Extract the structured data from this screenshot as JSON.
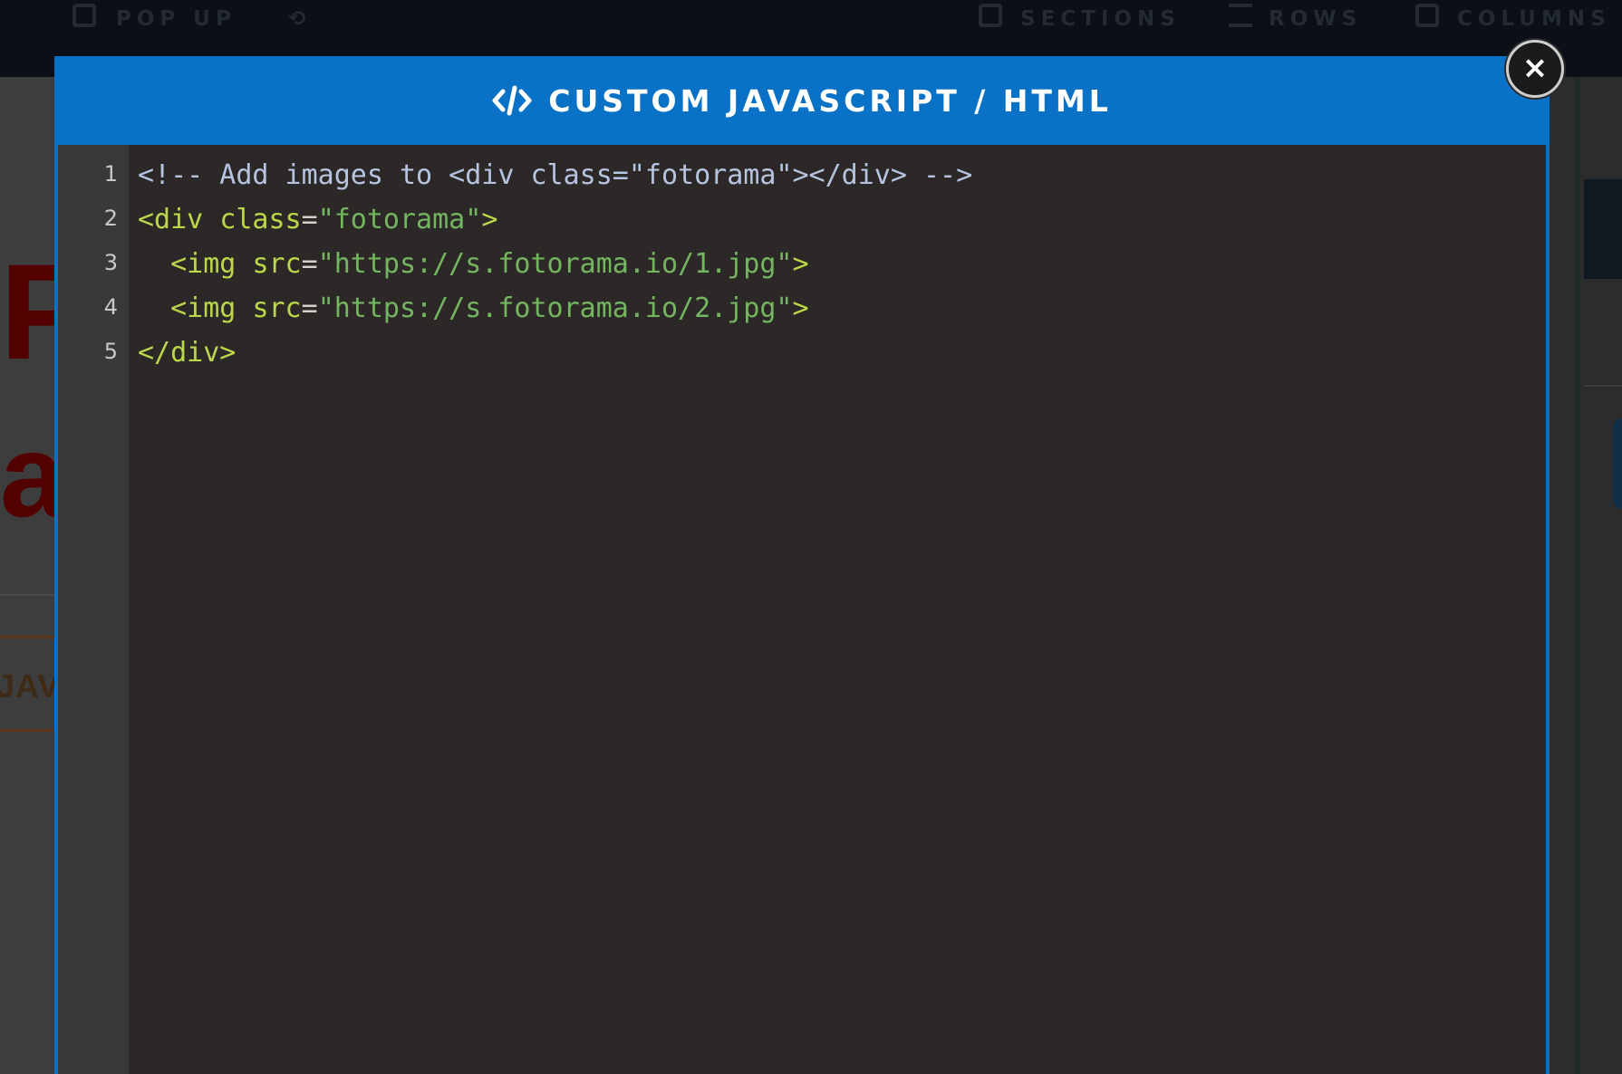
{
  "background": {
    "toolbar": {
      "popup_label": "POP UP",
      "sections_label": "SECTIONS",
      "rows_label": "ROWS",
      "columns_label": "COLUMNS"
    },
    "headline_fragment_1": "P",
    "headline_fragment_2": "al",
    "button_fragment": "JAV"
  },
  "modal": {
    "title": "CUSTOM JAVASCRIPT / HTML",
    "title_icon": "code-icon",
    "close_icon": "close-icon",
    "close_glyph": "×"
  },
  "editor": {
    "line_numbers": [
      "1",
      "2",
      "3",
      "4",
      "5"
    ],
    "lines": [
      {
        "tokens": [
          {
            "type": "comment",
            "text": "<!-- Add images to <div class=\"fotorama\"></div> -->"
          }
        ]
      },
      {
        "tokens": [
          {
            "type": "tag",
            "text": "<div"
          },
          {
            "type": "punct",
            "text": " "
          },
          {
            "type": "attr",
            "text": "class"
          },
          {
            "type": "punct",
            "text": "="
          },
          {
            "type": "str",
            "text": "\"fotorama\""
          },
          {
            "type": "tag",
            "text": ">"
          }
        ]
      },
      {
        "tokens": [
          {
            "type": "punct",
            "text": "  "
          },
          {
            "type": "tag",
            "text": "<img"
          },
          {
            "type": "punct",
            "text": " "
          },
          {
            "type": "attr",
            "text": "src"
          },
          {
            "type": "punct",
            "text": "="
          },
          {
            "type": "str",
            "text": "\"https://s.fotorama.io/1.jpg\""
          },
          {
            "type": "tag",
            "text": ">"
          }
        ]
      },
      {
        "tokens": [
          {
            "type": "punct",
            "text": "  "
          },
          {
            "type": "tag",
            "text": "<img"
          },
          {
            "type": "punct",
            "text": " "
          },
          {
            "type": "attr",
            "text": "src"
          },
          {
            "type": "punct",
            "text": "="
          },
          {
            "type": "str",
            "text": "\"https://s.fotorama.io/2.jpg\""
          },
          {
            "type": "tag",
            "text": ">"
          }
        ]
      },
      {
        "tokens": [
          {
            "type": "tag",
            "text": "</div>"
          }
        ]
      }
    ]
  },
  "colors": {
    "modal_blue": "#0a72c6",
    "editor_bg": "#2c2827",
    "gutter_bg": "#3a3939",
    "comment": "#b7c4e0",
    "tag": "#bcd84a",
    "string": "#74b560"
  }
}
